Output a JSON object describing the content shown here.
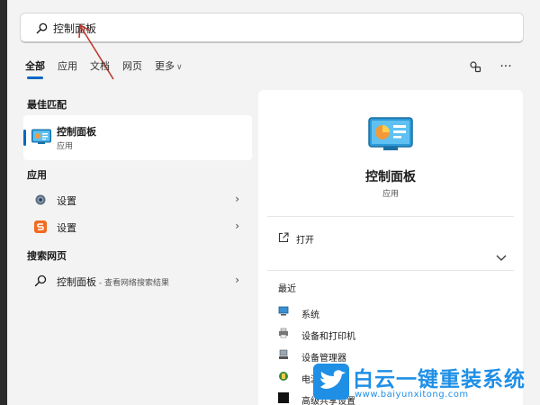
{
  "search": {
    "query": "控制面板",
    "icon": "search-icon"
  },
  "tabs": [
    {
      "label": "全部",
      "active": true
    },
    {
      "label": "应用"
    },
    {
      "label": "文档"
    },
    {
      "label": "网页"
    },
    {
      "label": "更多"
    }
  ],
  "toolbar": {
    "share_icon": "connect-icon",
    "more_icon": "more-ellipsis-icon",
    "more_glyph": "···"
  },
  "left": {
    "best_match_header": "最佳匹配",
    "best_match": {
      "title": "控制面板",
      "subtitle": "应用",
      "icon": "control-panel-icon"
    },
    "apps_header": "应用",
    "apps": [
      {
        "label": "设置",
        "icon": "gear-icon"
      },
      {
        "label": "设置",
        "icon": "sogou-s-icon"
      }
    ],
    "web_header": "搜索网页",
    "web": {
      "label": "控制面板",
      "suffix": " - 查看网络搜索结果",
      "icon": "search-icon"
    }
  },
  "detail": {
    "title": "控制面板",
    "subtitle": "应用",
    "open_label": "打开",
    "recent_header": "最近",
    "recent": [
      {
        "label": "系统",
        "icon": "system-icon"
      },
      {
        "label": "设备和打印机",
        "icon": "printer-icon"
      },
      {
        "label": "设备管理器",
        "icon": "device-manager-icon"
      },
      {
        "label": "电源",
        "icon": "power-icon"
      },
      {
        "label": "高级共享设置",
        "icon": "sharing-icon"
      }
    ]
  },
  "watermark": {
    "brand_cn": "白云一键重装系统",
    "brand_url": "www.baiyunxitong.com"
  },
  "colors": {
    "accent": "#0067c0",
    "annotation": "#c0392b",
    "watermark": "#1f8fe6"
  }
}
